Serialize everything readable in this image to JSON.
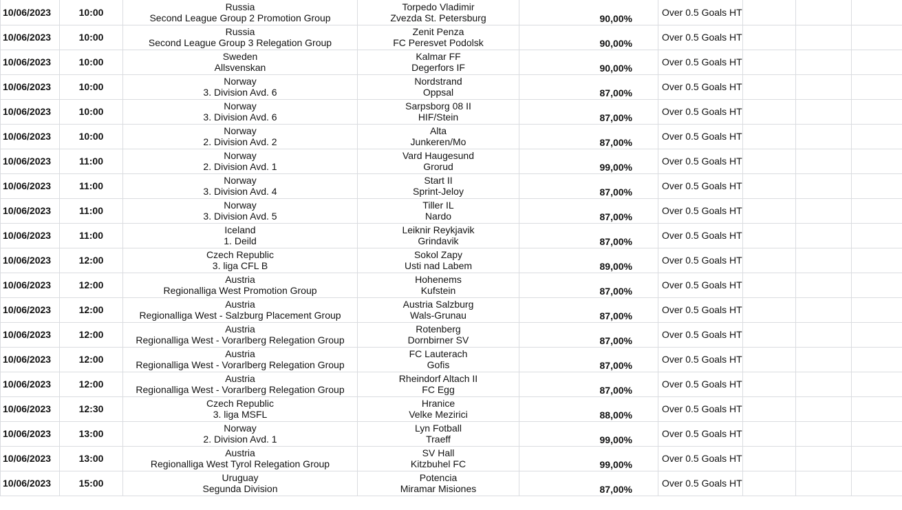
{
  "rows": [
    {
      "date": "10/06/2023",
      "time": "10:00",
      "country": "Russia",
      "league": "Second League Group 2 Promotion Group",
      "home": "Torpedo Vladimir",
      "away": "Zvezda St. Petersburg",
      "probability": "90,00%",
      "market": "Over 0.5 Goals HT"
    },
    {
      "date": "10/06/2023",
      "time": "10:00",
      "country": "Russia",
      "league": "Second League Group 3 Relegation Group",
      "home": "Zenit Penza",
      "away": "FC Peresvet Podolsk",
      "probability": "90,00%",
      "market": "Over 0.5 Goals HT"
    },
    {
      "date": "10/06/2023",
      "time": "10:00",
      "country": "Sweden",
      "league": "Allsvenskan",
      "home": "Kalmar FF",
      "away": "Degerfors IF",
      "probability": "90,00%",
      "market": "Over 0.5 Goals HT"
    },
    {
      "date": "10/06/2023",
      "time": "10:00",
      "country": "Norway",
      "league": "3. Division Avd. 6",
      "home": "Nordstrand",
      "away": "Oppsal",
      "probability": "87,00%",
      "market": "Over 0.5 Goals HT"
    },
    {
      "date": "10/06/2023",
      "time": "10:00",
      "country": "Norway",
      "league": "3. Division Avd. 6",
      "home": "Sarpsborg 08 II",
      "away": "HIF/Stein",
      "probability": "87,00%",
      "market": "Over 0.5 Goals HT"
    },
    {
      "date": "10/06/2023",
      "time": "10:00",
      "country": "Norway",
      "league": "2. Division Avd. 2",
      "home": "Alta",
      "away": "Junkeren/Mo",
      "probability": "87,00%",
      "market": "Over 0.5 Goals HT"
    },
    {
      "date": "10/06/2023",
      "time": "11:00",
      "country": "Norway",
      "league": "2. Division Avd. 1",
      "home": "Vard Haugesund",
      "away": "Grorud",
      "probability": "99,00%",
      "market": "Over 0.5 Goals HT"
    },
    {
      "date": "10/06/2023",
      "time": "11:00",
      "country": "Norway",
      "league": "3. Division Avd. 4",
      "home": "Start II",
      "away": "Sprint-Jeloy",
      "probability": "87,00%",
      "market": "Over 0.5 Goals HT"
    },
    {
      "date": "10/06/2023",
      "time": "11:00",
      "country": "Norway",
      "league": "3. Division Avd. 5",
      "home": "Tiller IL",
      "away": "Nardo",
      "probability": "87,00%",
      "market": "Over 0.5 Goals HT"
    },
    {
      "date": "10/06/2023",
      "time": "11:00",
      "country": "Iceland",
      "league": "1. Deild",
      "home": "Leiknir Reykjavik",
      "away": "Grindavik",
      "probability": "87,00%",
      "market": "Over 0.5 Goals HT"
    },
    {
      "date": "10/06/2023",
      "time": "12:00",
      "country": "Czech Republic",
      "league": "3. liga CFL B",
      "home": "Sokol Zapy",
      "away": "Usti nad Labem",
      "probability": "89,00%",
      "market": "Over 0.5 Goals HT"
    },
    {
      "date": "10/06/2023",
      "time": "12:00",
      "country": "Austria",
      "league": "Regionalliga West Promotion Group",
      "home": "Hohenems",
      "away": "Kufstein",
      "probability": "87,00%",
      "market": "Over 0.5 Goals HT"
    },
    {
      "date": "10/06/2023",
      "time": "12:00",
      "country": "Austria",
      "league": "Regionalliga West - Salzburg Placement Group",
      "home": "Austria Salzburg",
      "away": "Wals-Grunau",
      "probability": "87,00%",
      "market": "Over 0.5 Goals HT"
    },
    {
      "date": "10/06/2023",
      "time": "12:00",
      "country": "Austria",
      "league": "Regionalliga West - Vorarlberg Relegation Group",
      "home": "Rotenberg",
      "away": "Dornbirner SV",
      "probability": "87,00%",
      "market": "Over 0.5 Goals HT"
    },
    {
      "date": "10/06/2023",
      "time": "12:00",
      "country": "Austria",
      "league": "Regionalliga West - Vorarlberg Relegation Group",
      "home": "FC Lauterach",
      "away": "Gofis",
      "probability": "87,00%",
      "market": "Over 0.5 Goals HT"
    },
    {
      "date": "10/06/2023",
      "time": "12:00",
      "country": "Austria",
      "league": "Regionalliga West - Vorarlberg Relegation Group",
      "home": "Rheindorf Altach II",
      "away": "FC Egg",
      "probability": "87,00%",
      "market": "Over 0.5 Goals HT"
    },
    {
      "date": "10/06/2023",
      "time": "12:30",
      "country": "Czech Republic",
      "league": "3. liga MSFL",
      "home": "Hranice",
      "away": "Velke Mezirici",
      "probability": "88,00%",
      "market": "Over 0.5 Goals HT"
    },
    {
      "date": "10/06/2023",
      "time": "13:00",
      "country": "Norway",
      "league": "2. Division Avd. 1",
      "home": "Lyn Fotball",
      "away": "Traeff",
      "probability": "99,00%",
      "market": "Over 0.5 Goals HT"
    },
    {
      "date": "10/06/2023",
      "time": "13:00",
      "country": "Austria",
      "league": "Regionalliga West Tyrol Relegation Group",
      "home": "SV Hall",
      "away": "Kitzbuhel FC",
      "probability": "99,00%",
      "market": "Over 0.5 Goals HT"
    },
    {
      "date": "10/06/2023",
      "time": "15:00",
      "country": "Uruguay",
      "league": "Segunda Division",
      "home": "Potencia",
      "away": "Miramar Misiones",
      "probability": "87,00%",
      "market": "Over 0.5 Goals HT"
    }
  ]
}
